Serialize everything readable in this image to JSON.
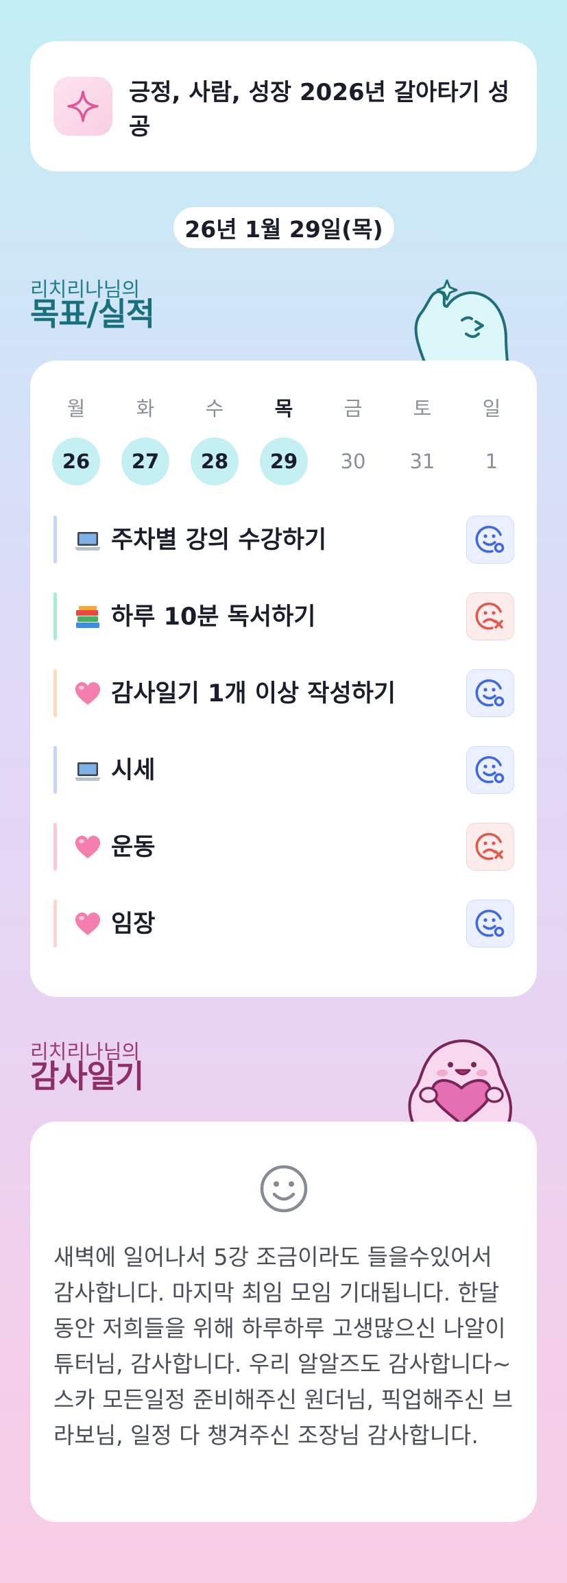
{
  "goal_banner": {
    "icon": "sparkle-icon",
    "text": "긍정, 사람, 성장 2026년 갈아타기 성공"
  },
  "date": "26년 1월 29일(목)",
  "goals_section": {
    "subtitle": "리치리나님의",
    "title": "목표/실적",
    "week": [
      {
        "day": "월",
        "date": "26",
        "done": true,
        "today": false
      },
      {
        "day": "화",
        "date": "27",
        "done": true,
        "today": false
      },
      {
        "day": "수",
        "date": "28",
        "done": true,
        "today": false
      },
      {
        "day": "목",
        "date": "29",
        "done": true,
        "today": true
      },
      {
        "day": "금",
        "date": "30",
        "done": false,
        "today": false
      },
      {
        "day": "토",
        "date": "31",
        "done": false,
        "today": false
      },
      {
        "day": "일",
        "date": "1",
        "done": false,
        "today": false
      }
    ],
    "items": [
      {
        "emoji": "laptop-icon",
        "label": "주차별 강의 수강하기",
        "status": "done",
        "bar_color": "#c9d6f3"
      },
      {
        "emoji": "books-icon",
        "label": "하루 10분 독서하기",
        "status": "missed",
        "bar_color": "#a9ecd6"
      },
      {
        "emoji": "heart-icon",
        "label": "감사일기 1개 이상 작성하기",
        "status": "done",
        "bar_color": "#fbd9c2"
      },
      {
        "emoji": "laptop-icon",
        "label": "시세",
        "status": "done",
        "bar_color": "#c9d6f3"
      },
      {
        "emoji": "heart-icon",
        "label": "운동",
        "status": "missed",
        "bar_color": "#f8c9dd"
      },
      {
        "emoji": "heart-icon",
        "label": "임장",
        "status": "done",
        "bar_color": "#fbd6d0"
      }
    ]
  },
  "gratitude_section": {
    "subtitle": "리치리나님의",
    "title": "감사일기",
    "mood_icon": "smile-face-icon",
    "text": "새벽에 일어나서 5강 조금이라도 들을수있어서 감사합니다. 마지막 최임 모임 기대됩니다. 한달 동안 저희들을 위해 하루하루 고생많으신 나알이 튜터님, 감사합니다. 우리 알알즈도 감사합니다~\n스카 모든일정 준비해주신 원더님, 픽업해주신 브라보님, 일정 다 챙겨주신 조장님 감사합니다."
  },
  "colors": {
    "done": "#3f67e0",
    "missed": "#e2564c",
    "accent_teal": "#17707b",
    "accent_purple": "#8e2f68"
  }
}
